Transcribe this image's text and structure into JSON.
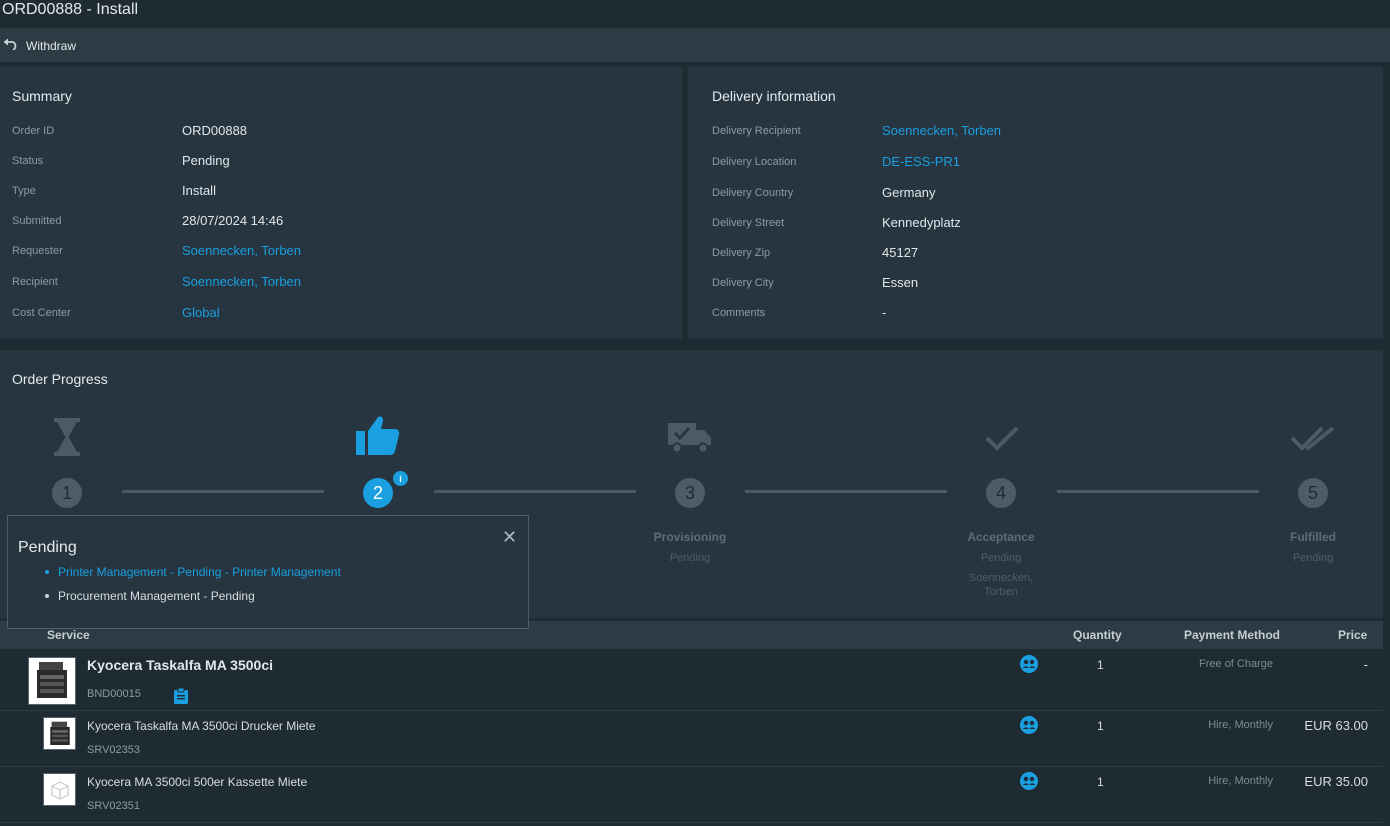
{
  "window": {
    "title": "ORD00888 - Install"
  },
  "toolbar": {
    "withdraw_label": "Withdraw"
  },
  "summary": {
    "title": "Summary",
    "fields": [
      {
        "label": "Order ID",
        "value": "ORD00888",
        "link": false
      },
      {
        "label": "Status",
        "value": "Pending",
        "link": false
      },
      {
        "label": "Type",
        "value": "Install",
        "link": false
      },
      {
        "label": "Submitted",
        "value": "28/07/2024 14:46",
        "link": false
      },
      {
        "label": "Requester",
        "value": "Soennecken, Torben",
        "link": true
      },
      {
        "label": "Recipient",
        "value": "Soennecken, Torben",
        "link": true
      },
      {
        "label": "Cost Center",
        "value": "Global",
        "link": true
      }
    ]
  },
  "delivery": {
    "title": "Delivery information",
    "fields": [
      {
        "label": "Delivery Recipient",
        "value": "Soennecken, Torben",
        "link": true
      },
      {
        "label": "Delivery Location",
        "value": "DE-ESS-PR1",
        "link": true
      },
      {
        "label": "Delivery Country",
        "value": "Germany",
        "link": false
      },
      {
        "label": "Delivery Street",
        "value": "Kennedyplatz",
        "link": false
      },
      {
        "label": "Delivery Zip",
        "value": "45127",
        "link": false
      },
      {
        "label": "Delivery City",
        "value": "Essen",
        "link": false
      },
      {
        "label": "Comments",
        "value": "-",
        "link": false
      }
    ]
  },
  "progress": {
    "title": "Order Progress",
    "steps": [
      {
        "num": "1",
        "icon": "hourglass-icon",
        "name": "",
        "status": "",
        "person": ""
      },
      {
        "num": "2",
        "icon": "thumbs-up-icon",
        "name": "",
        "status": "",
        "person": ""
      },
      {
        "num": "3",
        "icon": "truck-check-icon",
        "name": "Provisioning",
        "status": "Pending",
        "person": ""
      },
      {
        "num": "4",
        "icon": "check-icon",
        "name": "Acceptance",
        "status": "Pending",
        "person": "Soennecken, Torben"
      },
      {
        "num": "5",
        "icon": "double-check-icon",
        "name": "Fulfilled",
        "status": "Pending",
        "person": ""
      }
    ],
    "active_step": 2,
    "accent": "#1a9fe0"
  },
  "popup": {
    "title": "Pending",
    "close": "✕",
    "items": [
      {
        "text": "Printer Management - Pending - Printer Management",
        "link": true
      },
      {
        "text": "Procurement Management - Pending",
        "link": false
      }
    ]
  },
  "table": {
    "headers": {
      "service": "Service",
      "quantity": "Quantity",
      "payment": "Payment Method",
      "price": "Price"
    },
    "rows": [
      {
        "name": "Kyocera Taskalfa MA 3500ci",
        "code": "BND00015",
        "quantity": "1",
        "payment": "Free of Charge",
        "price": "-",
        "main": true
      },
      {
        "name": "Kyocera Taskalfa MA 3500ci Drucker Miete",
        "code": "SRV02353",
        "quantity": "1",
        "payment": "Hire, Monthly",
        "price": "EUR 63.00",
        "main": false
      },
      {
        "name": "Kyocera MA 3500ci 500er Kassette Miete",
        "code": "SRV02351",
        "quantity": "1",
        "payment": "Hire, Monthly",
        "price": "EUR 35.00",
        "main": false
      }
    ]
  }
}
